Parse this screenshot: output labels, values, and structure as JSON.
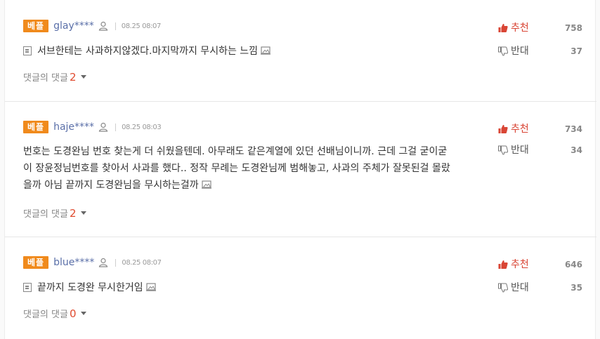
{
  "comments": [
    {
      "badge": "베플",
      "user": "glay****",
      "date": "08.25 08:07",
      "text": "서브한테는 사과하지않겠다.마지막까지 무시하는 느낌",
      "reply_label": "댓글의 댓글",
      "reply_count": "2",
      "upvote_label": "추천",
      "upvotes": "758",
      "downvote_label": "반대",
      "downvotes": "37"
    },
    {
      "badge": "베플",
      "user": "haje****",
      "date": "08.25 08:03",
      "text_lines": [
        "번호는 도경완님 번호 찾는게 더 쉬웠을텐데. 아무래도 같은계열에 있던 선배님이니까. 근데 그걸 굳이굳",
        "이 장윤정님번호를 찾아서 사과를 했다.. 정작 무례는 도경완님께 범해놓고, 사과의 주체가 잘못된걸 몰랐",
        "을까 아님 끝까지 도경완님을 무시하는걸까"
      ],
      "reply_label": "댓글의 댓글",
      "reply_count": "2",
      "upvote_label": "추천",
      "upvotes": "734",
      "downvote_label": "반대",
      "downvotes": "34"
    },
    {
      "badge": "베플",
      "user": "blue****",
      "date": "08.25 08:07",
      "text": "끝까지 도경완 무시한거임",
      "reply_label": "댓글의 댓글",
      "reply_count": "0",
      "upvote_label": "추천",
      "upvotes": "646",
      "downvote_label": "반대",
      "downvotes": "35"
    }
  ],
  "colors": {
    "badge": "#f08a1c",
    "username": "#5a6fa8",
    "upvote": "#d94535",
    "reply_count": "#e04b2f"
  }
}
